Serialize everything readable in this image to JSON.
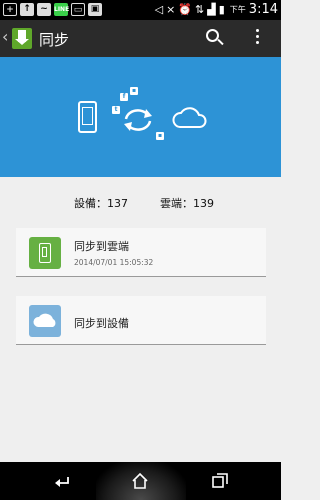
{
  "status_bar": {
    "time_prefix": "下午",
    "time": "3:14",
    "left_icons": [
      "add-icon",
      "upload-icon",
      "messenger-icon",
      "line-icon",
      "keyboard-icon",
      "image-icon"
    ],
    "right_icons": [
      "mute-icon",
      "close-icon",
      "alarm-icon",
      "data-icon",
      "signal-icon",
      "battery-icon"
    ]
  },
  "action_bar": {
    "title": "同步"
  },
  "counts": {
    "devices": "設備：137",
    "cloud": "雲端：139"
  },
  "cards": [
    {
      "title": "同步到雲端",
      "timestamp": "2014/07/01 15:05:32"
    },
    {
      "title": "同步到設備"
    }
  ],
  "colors": {
    "banner": "#2d93d6",
    "action_bar": "#2b2b2b",
    "sync_to_cloud_icon": "#66b043",
    "sync_to_device_icon": "#7cb2db"
  }
}
